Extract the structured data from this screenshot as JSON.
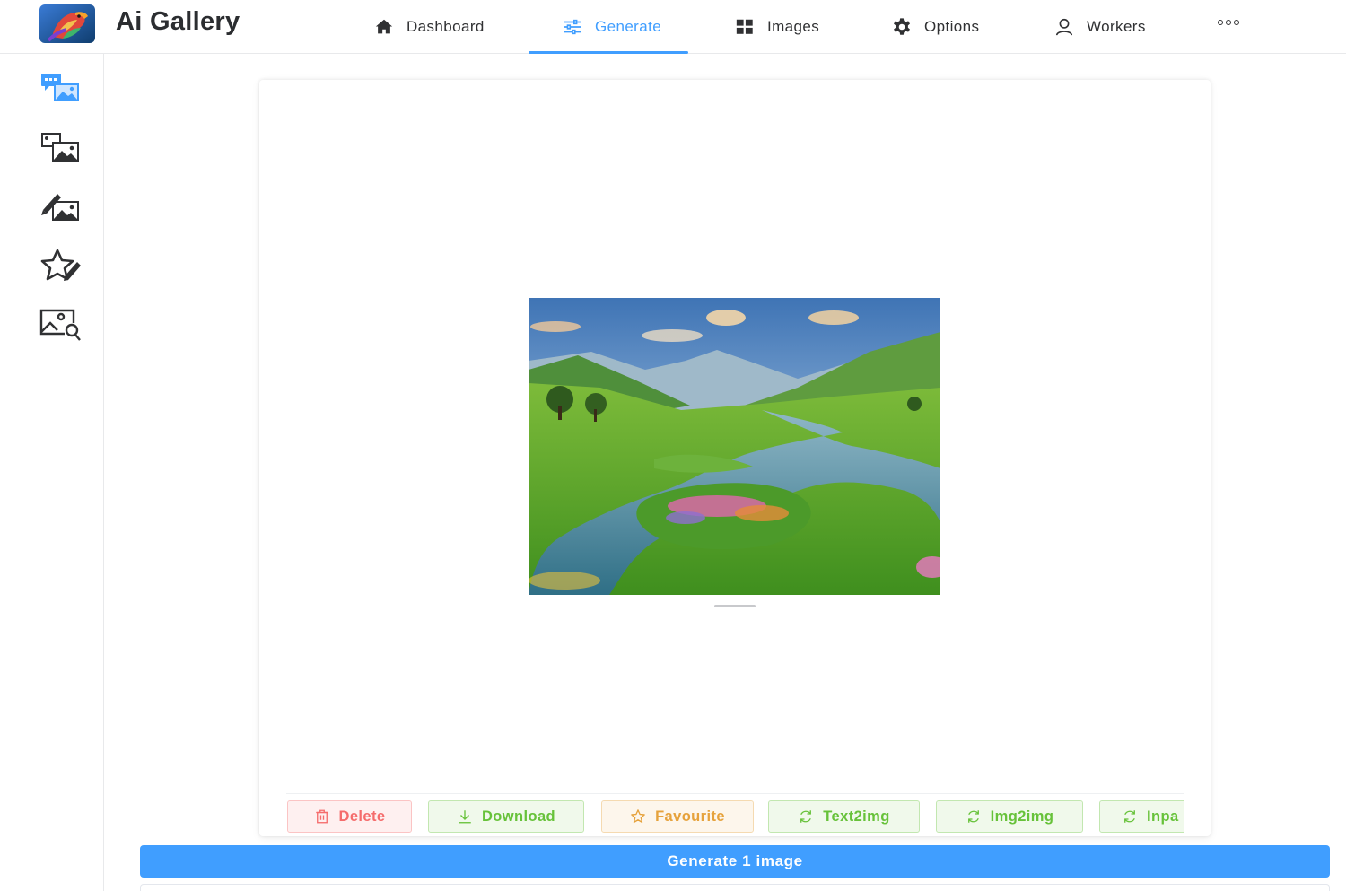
{
  "app": {
    "title": "Ai Gallery",
    "logo_icon": "parrot-logo-icon"
  },
  "nav": {
    "items": [
      {
        "label": "Dashboard",
        "icon": "home-icon",
        "active": false
      },
      {
        "label": "Generate",
        "icon": "sliders-icon",
        "active": true
      },
      {
        "label": "Images",
        "icon": "grid-icon",
        "active": false
      },
      {
        "label": "Options",
        "icon": "gear-icon",
        "active": false
      },
      {
        "label": "Workers",
        "icon": "user-icon",
        "active": false
      }
    ],
    "more_icon": "more-dots-icon"
  },
  "sidebar": {
    "items": [
      {
        "icon": "text-to-image-icon",
        "active": true
      },
      {
        "icon": "image-to-image-icon",
        "active": false
      },
      {
        "icon": "inpaint-icon",
        "active": false
      },
      {
        "icon": "favourite-edit-icon",
        "active": false
      },
      {
        "icon": "image-search-icon",
        "active": false
      }
    ]
  },
  "actions": {
    "delete": "Delete",
    "download": "Download",
    "favourite": "Favourite",
    "text2img": "Text2img",
    "img2img": "Img2img",
    "inpaint": "Inpa"
  },
  "generate": {
    "label": "Generate 1 image"
  },
  "colors": {
    "primary": "#409eff",
    "danger": "#f56c6c",
    "success": "#67c23a",
    "warning": "#e6a23c"
  }
}
